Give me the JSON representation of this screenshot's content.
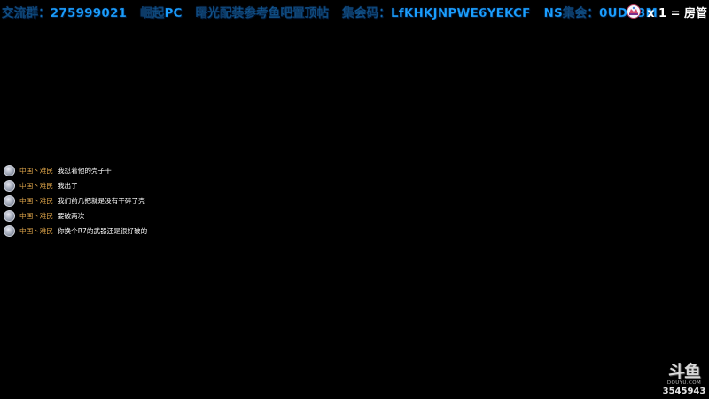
{
  "banner": {
    "group": "交流群：275999021",
    "pc": "崛起PC",
    "config": "曙光配装参考鱼吧置顶帖",
    "code": "集会码：LfKHKJNPWE6YEKCF",
    "ns": "NS集会：0UDK3M"
  },
  "room_admin": {
    "text": "x 1 = 房管"
  },
  "chat": {
    "messages": [
      {
        "user": "中国丶难民",
        "text": "我怼着他的壳子干"
      },
      {
        "user": "中国丶难民",
        "text": "我出了"
      },
      {
        "user": "中国丶难民",
        "text": "我们前几把就是没有干碎了壳"
      },
      {
        "user": "中国丶难民",
        "text": "要破两次"
      },
      {
        "user": "中国丶难民",
        "text": "你换个R7的武器还是很好破的"
      }
    ]
  },
  "watermark": {
    "logo": "斗鱼",
    "domain": "DOUYU.COM",
    "room_id": "3545943"
  }
}
